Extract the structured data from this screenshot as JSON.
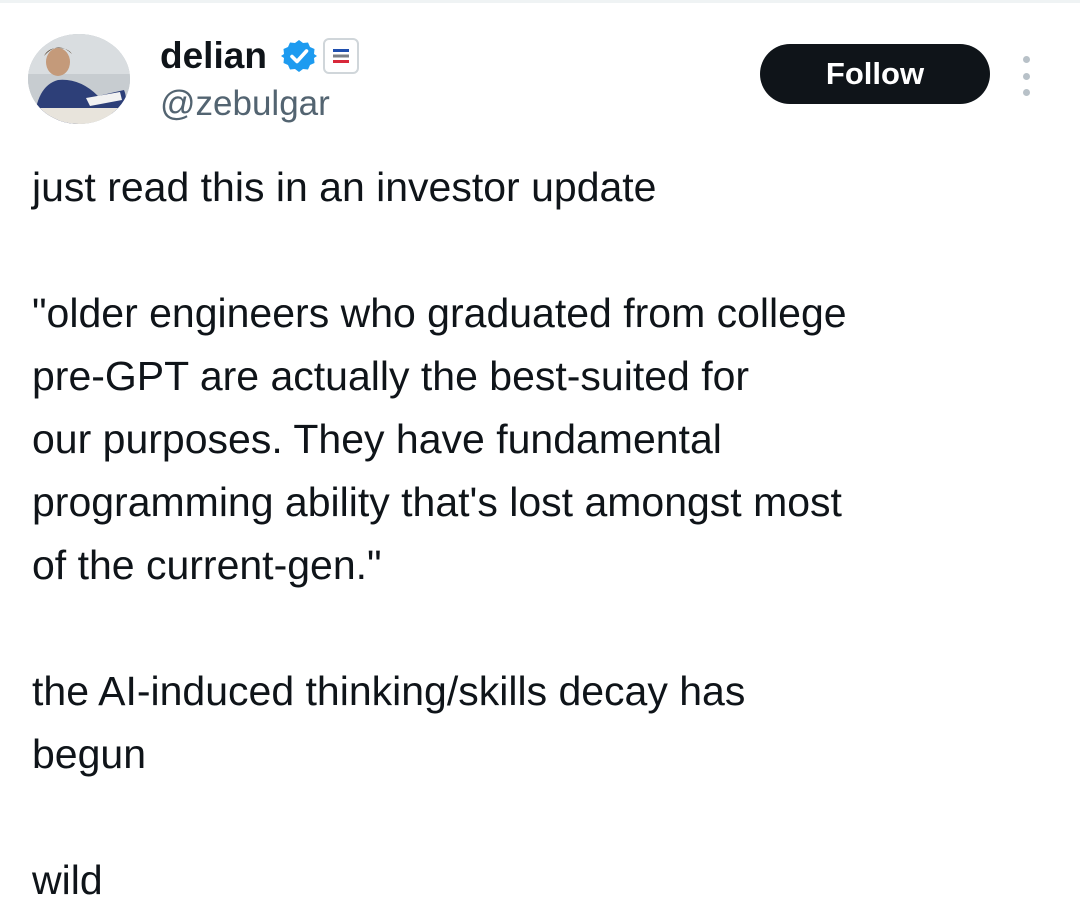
{
  "author": {
    "display_name": "delian",
    "handle": "@zebulgar",
    "verified_icon": "verified-badge-icon",
    "affiliate_icon": "affiliate-flag-icon",
    "accent_color": "#1d9bf0"
  },
  "actions": {
    "follow_label": "Follow",
    "more_icon": "more-vertical-icon"
  },
  "tweet": {
    "paragraphs": [
      {
        "lines": [
          "just read this in an investor update"
        ]
      },
      {
        "lines": [
          "\"older engineers who graduated from college",
          "pre-GPT are actually the best-suited for",
          "our purposes. They have fundamental",
          "programming ability that's lost amongst most",
          "of the current-gen.\""
        ]
      },
      {
        "lines": [
          "the AI-induced thinking/skills decay has",
          "begun"
        ]
      },
      {
        "lines": [
          "wild"
        ]
      }
    ]
  }
}
